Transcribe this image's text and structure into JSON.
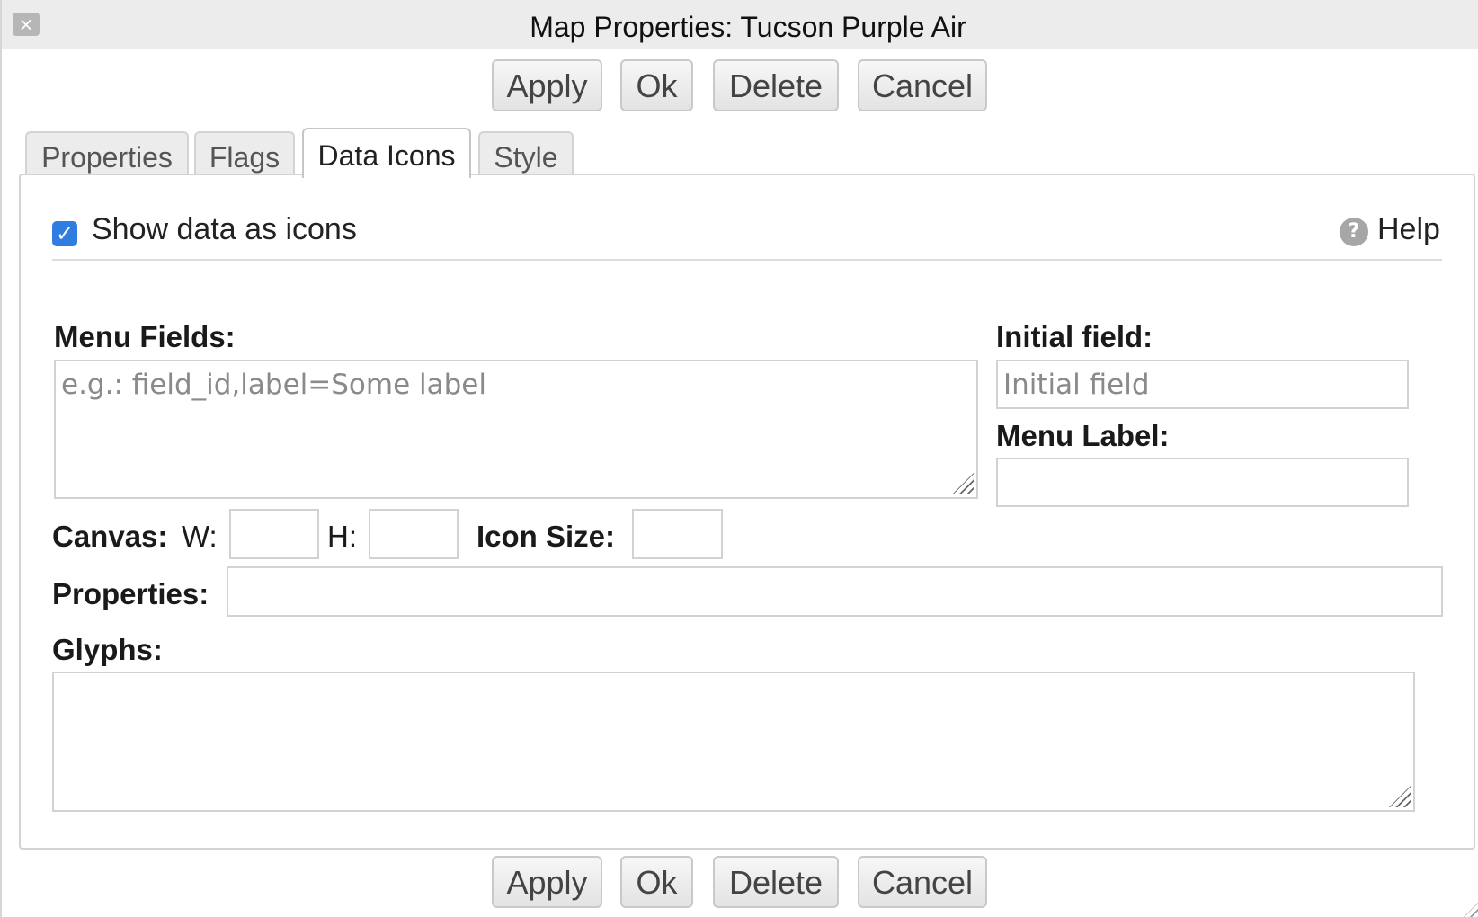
{
  "window": {
    "title": "Map Properties: Tucson Purple Air",
    "close_glyph": "×"
  },
  "buttons": {
    "apply": "Apply",
    "ok": "Ok",
    "delete": "Delete",
    "cancel": "Cancel"
  },
  "tabs": [
    {
      "label": "Properties"
    },
    {
      "label": "Flags"
    },
    {
      "label": "Data Icons",
      "active": true
    },
    {
      "label": "Style"
    }
  ],
  "data_icons": {
    "show_as_icons": {
      "label": "Show data as icons",
      "checked": true
    },
    "help": {
      "label": "Help",
      "icon": "help-circle-icon"
    },
    "menu_fields": {
      "label": "Menu Fields:",
      "value": "",
      "placeholder": "e.g.: field_id,label=Some label"
    },
    "initial_field": {
      "label": "Initial field:",
      "value": "",
      "placeholder": "Initial field"
    },
    "menu_label": {
      "label": "Menu Label:",
      "value": ""
    },
    "canvas": {
      "label": "Canvas:",
      "w_label": "W:",
      "h_label": "H:",
      "w_value": "",
      "h_value": ""
    },
    "icon_size": {
      "label": "Icon Size:",
      "value": ""
    },
    "properties": {
      "label": "Properties:",
      "value": ""
    },
    "glyphs": {
      "label": "Glyphs:",
      "value": ""
    }
  },
  "colors": {
    "checkbox": "#2f7de1",
    "titlebar": "#ececec"
  }
}
